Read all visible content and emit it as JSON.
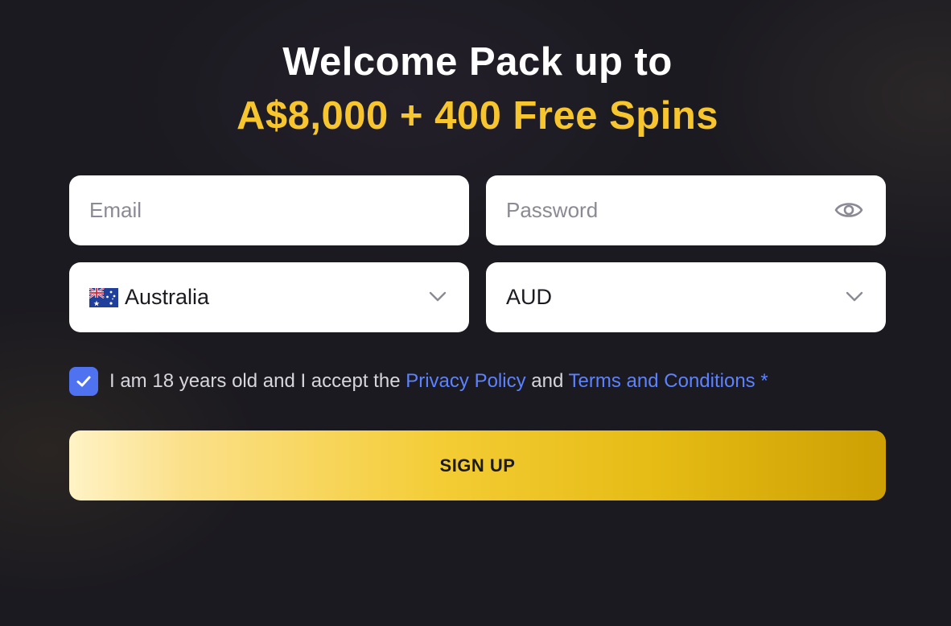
{
  "promo": {
    "line1": "Welcome Pack up to",
    "line2": "A$8,000 + 400 Free Spins"
  },
  "form": {
    "email_placeholder": "Email",
    "password_placeholder": "Password",
    "password_toggle_icon": "eye-icon",
    "country": {
      "selected": "Australia",
      "flag_icon": "australia-flag-icon",
      "dropdown_icon": "chevron-down-icon"
    },
    "currency": {
      "selected": "AUD",
      "dropdown_icon": "chevron-down-icon"
    },
    "agreement": {
      "checked": true,
      "text_before": "I am 18 years old and I accept the",
      "privacy_link": "Privacy Policy",
      "conjunction": "and",
      "terms_link": "Terms and Conditions",
      "required_mark": "*"
    },
    "submit_label": "SIGN UP"
  },
  "colors": {
    "background": "#1b1a20",
    "accent_yellow": "#f7c62f",
    "link_blue": "#5d82ff",
    "checkbox_blue": "#4f72f0"
  }
}
